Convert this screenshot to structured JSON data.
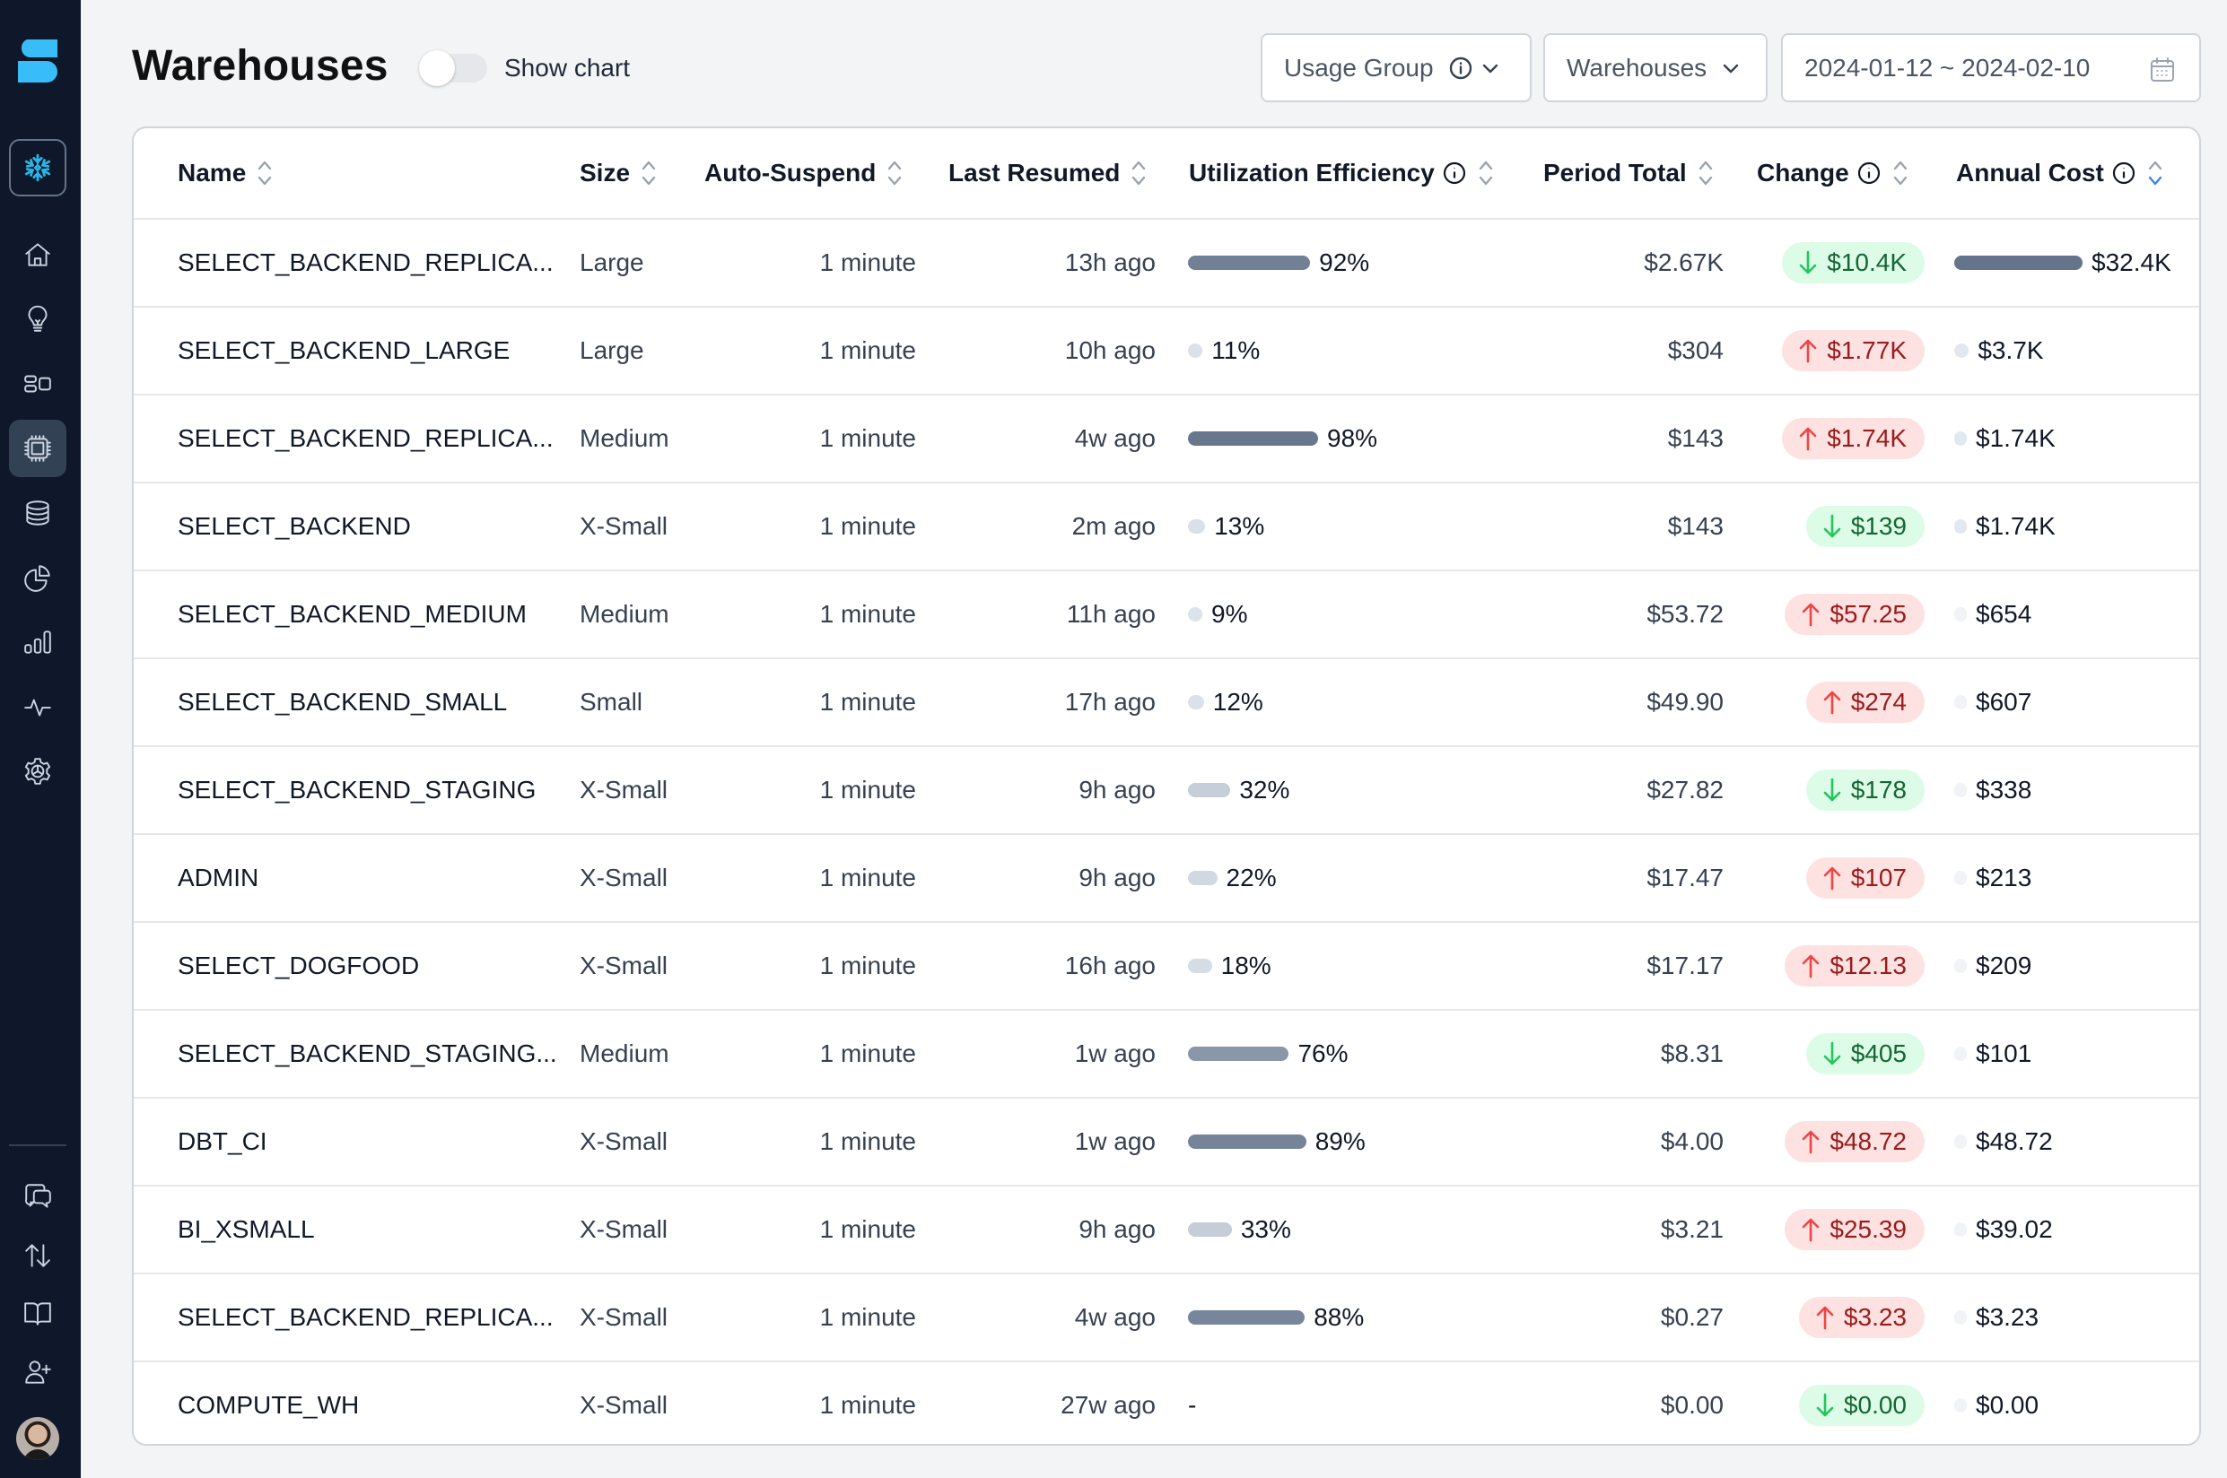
{
  "sidebar": {
    "logo": "select-logo",
    "top_items": [
      {
        "name": "snowflake-account",
        "icon": "snowflake-icon"
      },
      {
        "name": "home",
        "icon": "home-icon"
      },
      {
        "name": "insights",
        "icon": "lightbulb-icon"
      },
      {
        "name": "dashboards",
        "icon": "layout-icon"
      },
      {
        "name": "warehouses",
        "icon": "cpu-chip-icon",
        "active": true
      },
      {
        "name": "databases",
        "icon": "database-icon"
      },
      {
        "name": "usage-groups",
        "icon": "pie-chart-icon"
      },
      {
        "name": "reports",
        "icon": "bar-chart-icon"
      },
      {
        "name": "monitoring",
        "icon": "activity-icon"
      },
      {
        "name": "settings",
        "icon": "gear-icon"
      }
    ],
    "bottom_items": [
      {
        "name": "feedback",
        "icon": "chat-bubbles-icon"
      },
      {
        "name": "data-transfer",
        "icon": "arrows-up-down-icon"
      },
      {
        "name": "docs",
        "icon": "book-icon"
      },
      {
        "name": "invite-user",
        "icon": "user-plus-icon"
      }
    ]
  },
  "header": {
    "title": "Warehouses",
    "show_chart_label": "Show chart",
    "show_chart_on": false,
    "usage_group_label": "Usage Group",
    "warehouses_filter_label": "Warehouses",
    "date_range": "2024-01-12 ~ 2024-02-10"
  },
  "table": {
    "columns": {
      "name": "Name",
      "size": "Size",
      "auto_suspend": "Auto-Suspend",
      "last_resumed": "Last Resumed",
      "utilization": "Utilization Efficiency",
      "period_total": "Period Total",
      "change": "Change",
      "annual_cost": "Annual Cost"
    },
    "sorted_by": "annual_cost",
    "sort_direction": "desc",
    "colors": {
      "bar_low": "#e2e8f0",
      "bar_high": "#64748b",
      "change_down_bg": "#dcfce7",
      "change_up_bg": "#fee2e2",
      "sort_active": "#3b82f6"
    },
    "rows": [
      {
        "name": "SELECT_BACKEND_REPLICA...",
        "size": "Large",
        "auto_suspend": "1 minute",
        "last_resumed": "13h ago",
        "utilization": 92,
        "utilization_label": "92%",
        "period_total": "$2.67K",
        "change_dir": "down",
        "change": "$10.4K",
        "annual_cost": "$32.4K",
        "annual_value": 32400
      },
      {
        "name": "SELECT_BACKEND_LARGE",
        "size": "Large",
        "auto_suspend": "1 minute",
        "last_resumed": "10h ago",
        "utilization": 11,
        "utilization_label": "11%",
        "period_total": "$304",
        "change_dir": "up",
        "change": "$1.77K",
        "annual_cost": "$3.7K",
        "annual_value": 3700
      },
      {
        "name": "SELECT_BACKEND_REPLICA...",
        "size": "Medium",
        "auto_suspend": "1 minute",
        "last_resumed": "4w ago",
        "utilization": 98,
        "utilization_label": "98%",
        "period_total": "$143",
        "change_dir": "up",
        "change": "$1.74K",
        "annual_cost": "$1.74K",
        "annual_value": 1740
      },
      {
        "name": "SELECT_BACKEND",
        "size": "X-Small",
        "auto_suspend": "1 minute",
        "last_resumed": "2m ago",
        "utilization": 13,
        "utilization_label": "13%",
        "period_total": "$143",
        "change_dir": "down",
        "change": "$139",
        "annual_cost": "$1.74K",
        "annual_value": 1740
      },
      {
        "name": "SELECT_BACKEND_MEDIUM",
        "size": "Medium",
        "auto_suspend": "1 minute",
        "last_resumed": "11h ago",
        "utilization": 9,
        "utilization_label": "9%",
        "period_total": "$53.72",
        "change_dir": "up",
        "change": "$57.25",
        "annual_cost": "$654",
        "annual_value": 654
      },
      {
        "name": "SELECT_BACKEND_SMALL",
        "size": "Small",
        "auto_suspend": "1 minute",
        "last_resumed": "17h ago",
        "utilization": 12,
        "utilization_label": "12%",
        "period_total": "$49.90",
        "change_dir": "up",
        "change": "$274",
        "annual_cost": "$607",
        "annual_value": 607
      },
      {
        "name": "SELECT_BACKEND_STAGING",
        "size": "X-Small",
        "auto_suspend": "1 minute",
        "last_resumed": "9h ago",
        "utilization": 32,
        "utilization_label": "32%",
        "period_total": "$27.82",
        "change_dir": "down",
        "change": "$178",
        "annual_cost": "$338",
        "annual_value": 338
      },
      {
        "name": "ADMIN",
        "size": "X-Small",
        "auto_suspend": "1 minute",
        "last_resumed": "9h ago",
        "utilization": 22,
        "utilization_label": "22%",
        "period_total": "$17.47",
        "change_dir": "up",
        "change": "$107",
        "annual_cost": "$213",
        "annual_value": 213
      },
      {
        "name": "SELECT_DOGFOOD",
        "size": "X-Small",
        "auto_suspend": "1 minute",
        "last_resumed": "16h ago",
        "utilization": 18,
        "utilization_label": "18%",
        "period_total": "$17.17",
        "change_dir": "up",
        "change": "$12.13",
        "annual_cost": "$209",
        "annual_value": 209
      },
      {
        "name": "SELECT_BACKEND_STAGING...",
        "size": "Medium",
        "auto_suspend": "1 minute",
        "last_resumed": "1w ago",
        "utilization": 76,
        "utilization_label": "76%",
        "period_total": "$8.31",
        "change_dir": "down",
        "change": "$405",
        "annual_cost": "$101",
        "annual_value": 101
      },
      {
        "name": "DBT_CI",
        "size": "X-Small",
        "auto_suspend": "1 minute",
        "last_resumed": "1w ago",
        "utilization": 89,
        "utilization_label": "89%",
        "period_total": "$4.00",
        "change_dir": "up",
        "change": "$48.72",
        "annual_cost": "$48.72",
        "annual_value": 48.72
      },
      {
        "name": "BI_XSMALL",
        "size": "X-Small",
        "auto_suspend": "1 minute",
        "last_resumed": "9h ago",
        "utilization": 33,
        "utilization_label": "33%",
        "period_total": "$3.21",
        "change_dir": "up",
        "change": "$25.39",
        "annual_cost": "$39.02",
        "annual_value": 39.02
      },
      {
        "name": "SELECT_BACKEND_REPLICA...",
        "size": "X-Small",
        "auto_suspend": "1 minute",
        "last_resumed": "4w ago",
        "utilization": 88,
        "utilization_label": "88%",
        "period_total": "$0.27",
        "change_dir": "up",
        "change": "$3.23",
        "annual_cost": "$3.23",
        "annual_value": 3.23
      },
      {
        "name": "COMPUTE_WH",
        "size": "X-Small",
        "auto_suspend": "1 minute",
        "last_resumed": "27w ago",
        "utilization": null,
        "utilization_label": "-",
        "period_total": "$0.00",
        "change_dir": "down",
        "change": "$0.00",
        "annual_cost": "$0.00",
        "annual_value": 0
      }
    ]
  }
}
